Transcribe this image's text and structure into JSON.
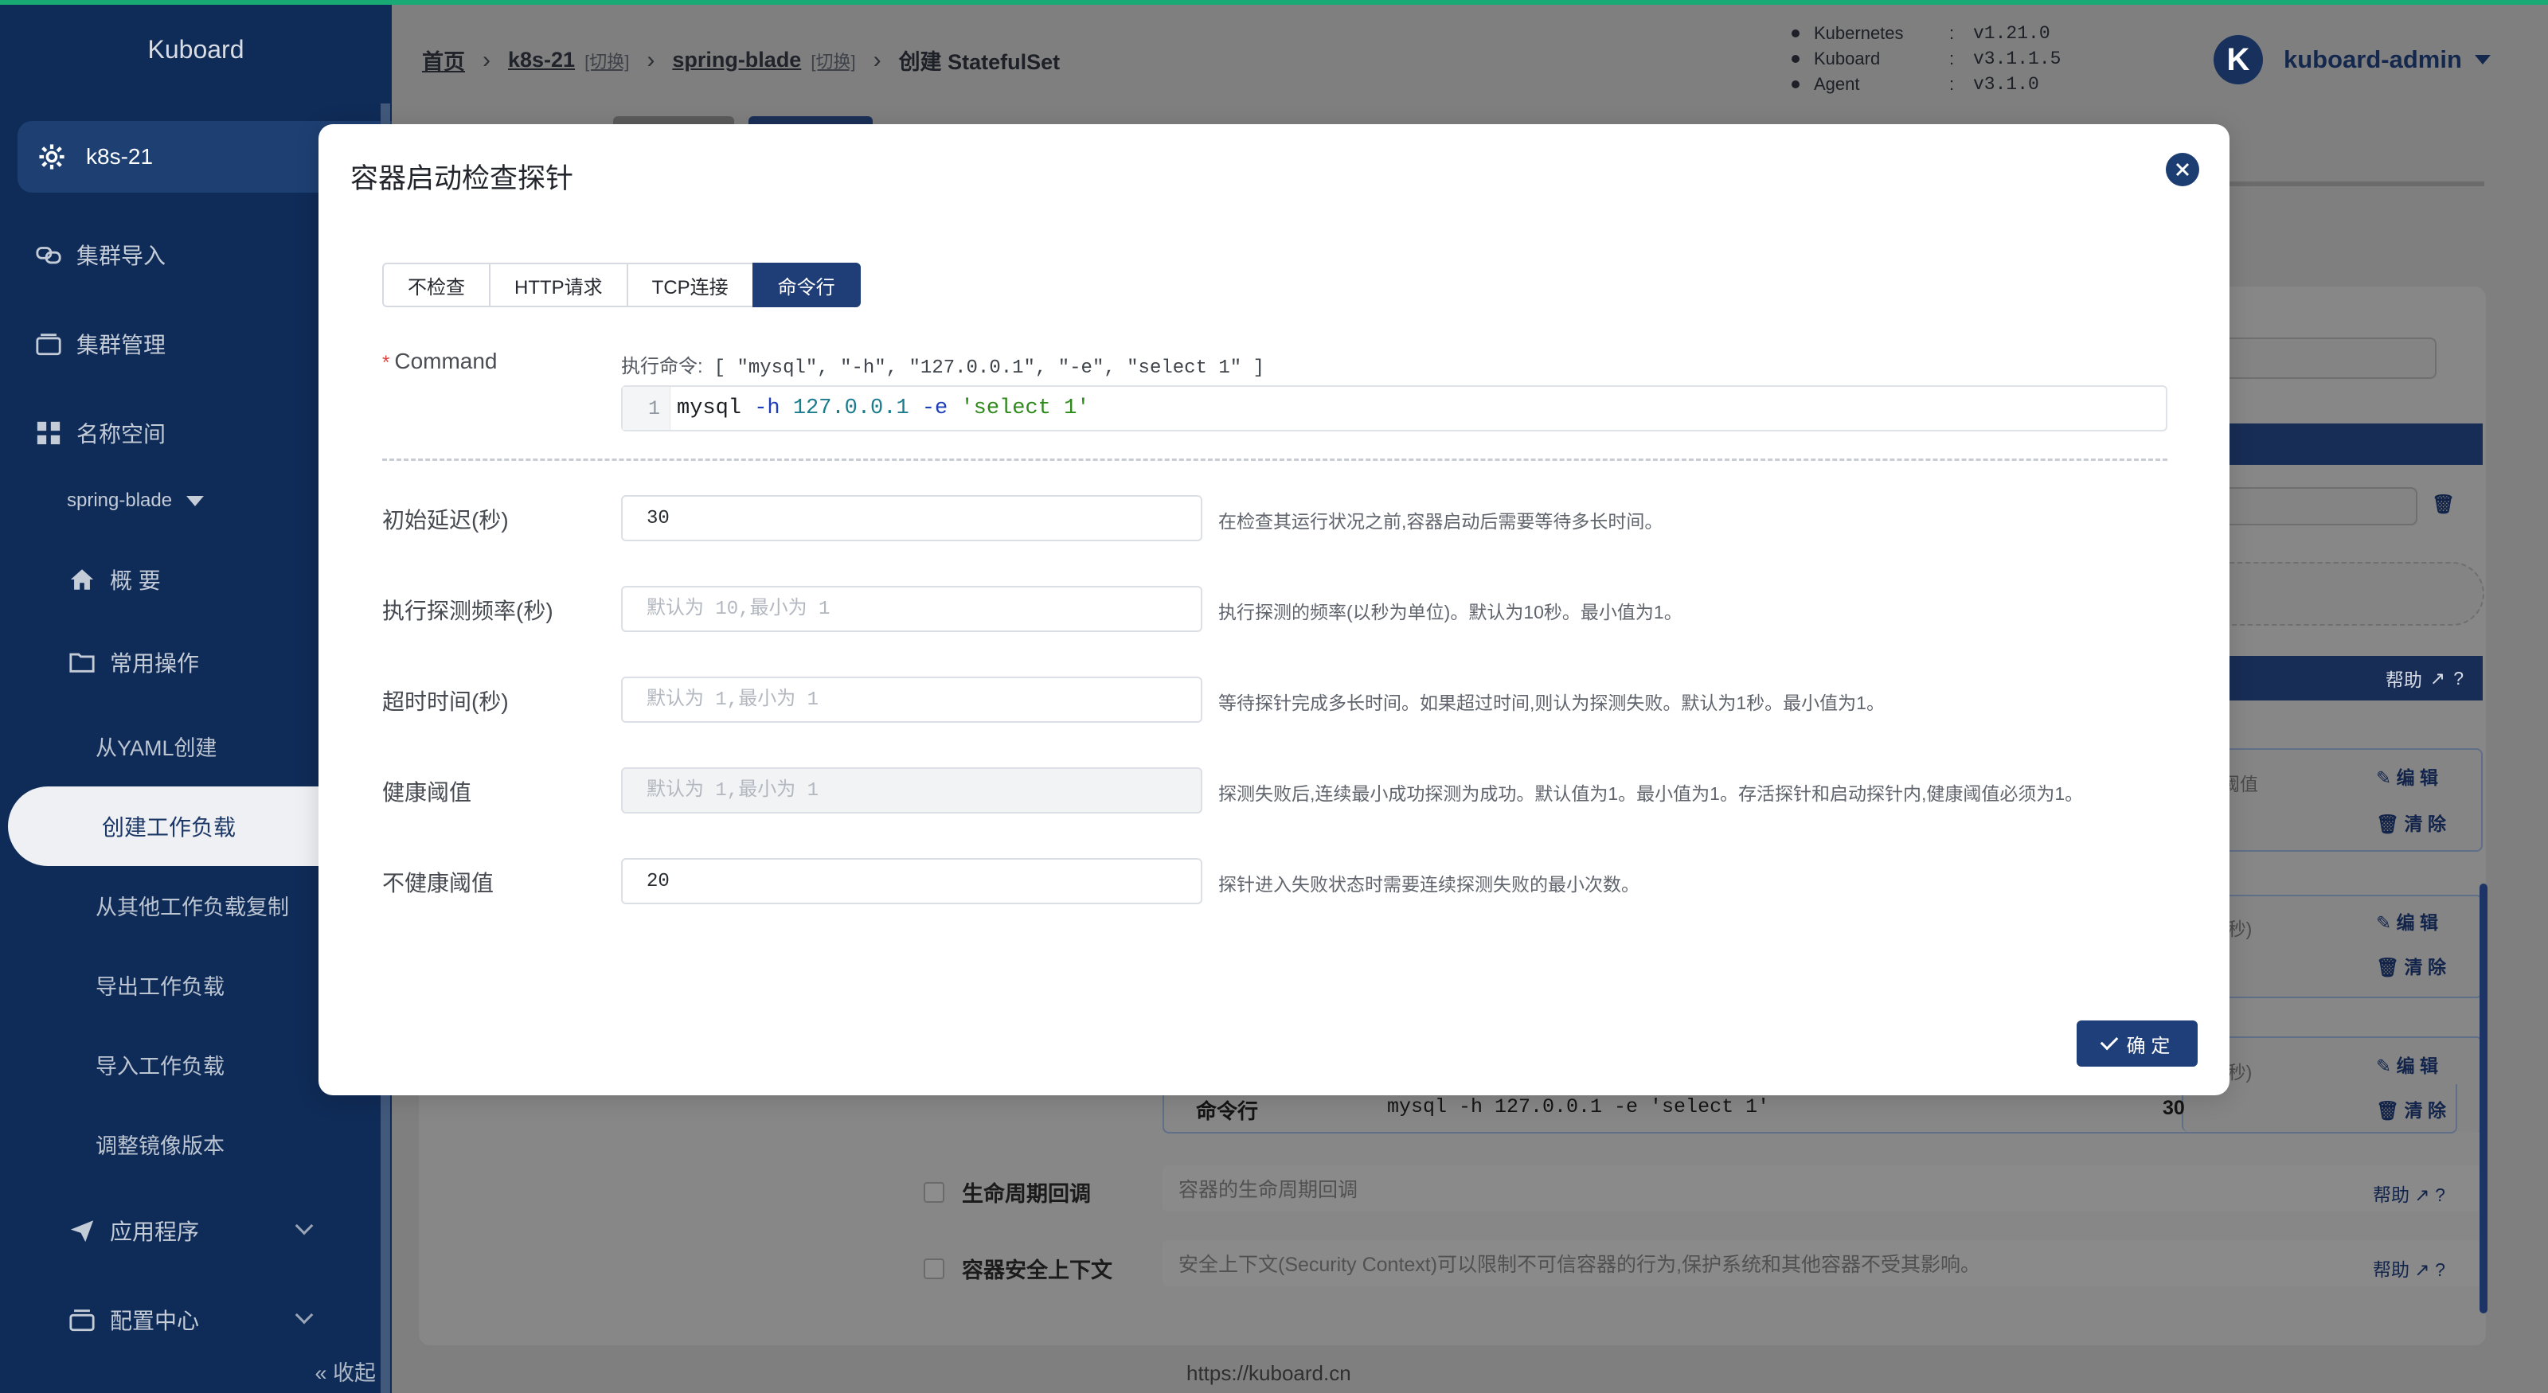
{
  "sidebar": {
    "logo": "Kuboard",
    "cluster": "k8s-21",
    "items": [
      {
        "label": "集群导入",
        "icon": "link-icon"
      },
      {
        "label": "集群管理",
        "icon": "storage-icon"
      },
      {
        "label": "名称空间",
        "icon": "grid-icon"
      }
    ],
    "namespace": "spring-blade",
    "overview": "概 要",
    "common_ops": "常用操作",
    "sub_items": [
      "从YAML创建",
      "创建工作负载",
      "从其他工作负载复制",
      "导出工作负载",
      "导入工作负载",
      "调整镜像版本"
    ],
    "apps": "应用程序",
    "config": "配置中心",
    "collapse": "收起"
  },
  "header": {
    "breadcrumb": {
      "home": "首页",
      "cluster": "k8s-21",
      "switch1": "[切换]",
      "namespace": "spring-blade",
      "switch2": "[切换]",
      "current": "创建 StatefulSet"
    },
    "versions": [
      {
        "name": "Kubernetes",
        "value": "v1.21.0"
      },
      {
        "name": "Kuboard",
        "value": "v3.1.1.5"
      },
      {
        "name": "Agent",
        "value": "v3.1.0"
      }
    ],
    "avatar_letter": "K",
    "username": "kuboard-admin"
  },
  "background": {
    "help": "帮助",
    "edit": "编 辑",
    "clear": "清 除",
    "threshold_label": "阈值",
    "seconds_label": "(秒)",
    "row": {
      "type": "命令行",
      "command": "mysql -h 127.0.0.1 -e 'select 1'",
      "value": "30"
    },
    "lifecycle": {
      "label": "生命周期回调",
      "placeholder": "容器的生命周期回调"
    },
    "security": {
      "label": "容器安全上下文",
      "placeholder": "安全上下文(Security Context)可以限制不可信容器的行为,保护系统和其他容器不受其影响。"
    },
    "footer": "https://kuboard.cn"
  },
  "modal": {
    "title": "容器启动检查探针",
    "tabs": [
      "不检查",
      "HTTP请求",
      "TCP连接",
      "命令行"
    ],
    "active_tab": "命令行",
    "command": {
      "label": "Command",
      "hint_label": "执行命令:",
      "hint_value": "[ \"mysql\", \"-h\", \"127.0.0.1\", \"-e\", \"select 1\" ]",
      "line_no": "1",
      "code_parts": [
        "mysql",
        "-h",
        "127.0.0.1",
        "-e",
        "'select 1'"
      ]
    },
    "fields": [
      {
        "label": "初始延迟(秒)",
        "value": "30",
        "placeholder": "",
        "desc": "在检查其运行状况之前,容器启动后需要等待多长时间。"
      },
      {
        "label": "执行探测频率(秒)",
        "value": "",
        "placeholder": "默认为 10,最小为 1",
        "desc": "执行探测的频率(以秒为单位)。默认为10秒。最小值为1。"
      },
      {
        "label": "超时时间(秒)",
        "value": "",
        "placeholder": "默认为 1,最小为 1",
        "desc": "等待探针完成多长时间。如果超过时间,则认为探测失败。默认为1秒。最小值为1。"
      },
      {
        "label": "健康阈值",
        "value": "",
        "placeholder": "默认为 1,最小为 1",
        "desc": "探测失败后,连续最小成功探测为成功。默认值为1。最小值为1。存活探针和启动探针内,健康阈值必须为1。"
      },
      {
        "label": "不健康阈值",
        "value": "20",
        "placeholder": "",
        "desc": "探针进入失败状态时需要连续探测失败的最小次数。"
      }
    ],
    "ok_button": "确 定"
  }
}
